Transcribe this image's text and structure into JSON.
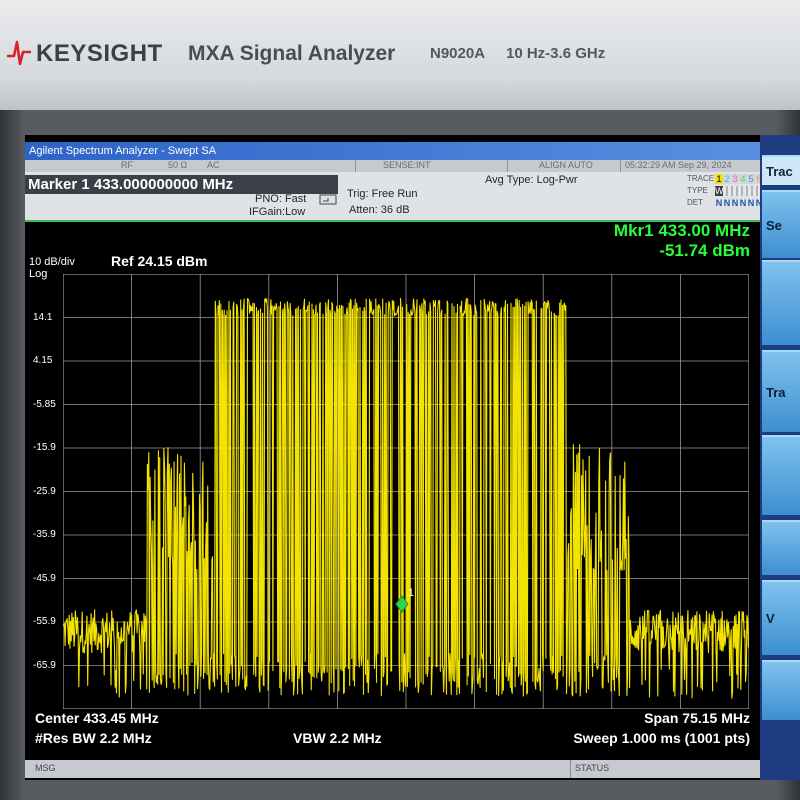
{
  "bezel": {
    "brand": "KEYSIGHT",
    "model_name": "MXA Signal Analyzer",
    "model_number": "N9020A",
    "freq_range": "10 Hz-3.6 GHz"
  },
  "window": {
    "title": "Agilent Spectrum Analyzer - Swept SA"
  },
  "status_strip": {
    "rf": "RF",
    "impedance": "50 Ω",
    "coupling": "AC",
    "sense": "SENSE:INT",
    "align": "ALIGN AUTO",
    "timestamp": "05:32:29 AM Sep 29, 2024"
  },
  "info": {
    "marker_readout": "Marker 1 433.000000000 MHz",
    "pno": "PNO: Fast",
    "ifgain": "IFGain:Low",
    "trig": "Trig: Free Run",
    "atten": "Atten: 36 dB",
    "avg_type": "Avg Type: Log-Pwr",
    "trace": {
      "trace_label": "TRACE",
      "type_label": "TYPE",
      "det_label": "DET",
      "trace_values": [
        "1",
        "2",
        "3",
        "4",
        "5",
        "6"
      ],
      "type_value": "W",
      "det_values": [
        "N",
        "N",
        "N",
        "N",
        "N",
        "N"
      ]
    }
  },
  "plot": {
    "scale": "10 dB/div",
    "scale_type": "Log",
    "ref_level": "Ref 24.15 dBm",
    "marker_freq": "Mkr1 433.00 MHz",
    "marker_level": "-51.74 dBm",
    "marker_label": "1",
    "y_labels": [
      "14.1",
      "4.15",
      "-5.85",
      "-15.9",
      "-25.9",
      "-35.9",
      "-45.9",
      "-55.9",
      "-65.9"
    ]
  },
  "footer": {
    "center": "Center 433.45 MHz",
    "span": "Span 75.15 MHz",
    "res_bw": "#Res BW 2.2 MHz",
    "vbw": "VBW 2.2 MHz",
    "sweep": "Sweep  1.000 ms (1001 pts)"
  },
  "message_bar": {
    "msg": "MSG",
    "status": "STATUS"
  },
  "softkeys": {
    "items": [
      "Trac",
      "Se",
      "",
      "Tra",
      "",
      "",
      "V",
      ""
    ]
  },
  "chart_data": {
    "type": "line",
    "title": "",
    "xlabel": "",
    "ylabel": "",
    "x_center_mhz": 433.45,
    "x_span_mhz": 75.15,
    "x_range_mhz": [
      395.875,
      471.025
    ],
    "ylim_dbm": [
      -75.85,
      24.15
    ],
    "y_ticks_dbm": [
      14.1,
      4.15,
      -5.85,
      -15.9,
      -25.9,
      -35.9,
      -45.9,
      -55.9,
      -65.9
    ],
    "noise_floor_dbm": -58,
    "plateau_level_dbm": 18.5,
    "plateau_range_mhz": [
      412.5,
      451.0
    ],
    "shoulder_range_mhz": [
      405.0,
      458.0
    ],
    "marker": {
      "freq_mhz": 433.0,
      "level_dbm": -51.74
    },
    "points": 1001,
    "grid": true
  }
}
